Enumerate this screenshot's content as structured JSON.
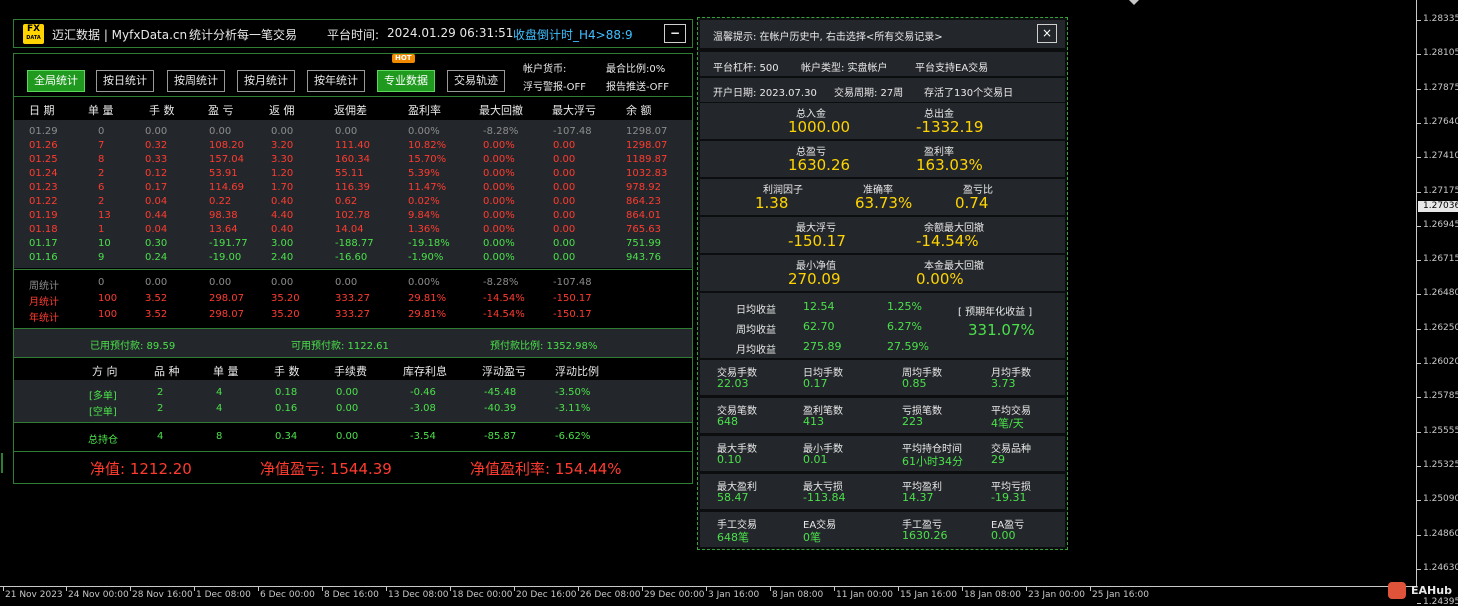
{
  "header": {
    "logo_top": "FX",
    "logo_bottom": "DATA",
    "title": "迈汇数据 | MyfxData.cn",
    "subtitle": "统计分析每一笔交易",
    "time_label": "平台时间:",
    "time_value": "2024.01.29 06:31:51",
    "countdown": "收盘倒计时_H4>88:9",
    "minimize": "−"
  },
  "tabs": [
    "全局统计",
    "按日统计",
    "按周统计",
    "按月统计",
    "按年统计",
    "专业数据",
    "交易轨迹"
  ],
  "hot_badge": "HOT",
  "side_info": {
    "currency": "帐户货币:",
    "margin": "最合比例:0%",
    "float_alert": "浮亏警报-OFF",
    "report_push": "报告推送-OFF"
  },
  "table_headers": [
    "日 期",
    "单 量",
    "手 数",
    "盈 亏",
    "返 佣",
    "返佣差",
    "盈利率",
    "最大回撤",
    "最大浮亏",
    "余 额"
  ],
  "daily_rows": [
    {
      "cells": [
        "01.29",
        "0",
        "0.00",
        "0.00",
        "0.00",
        "0.00",
        "0.00%",
        "-8.28%",
        "-107.48",
        "1298.07"
      ],
      "color": "gray"
    },
    {
      "cells": [
        "01.26",
        "7",
        "0.32",
        "108.20",
        "3.20",
        "111.40",
        "10.82%",
        "0.00%",
        "0.00",
        "1298.07"
      ],
      "color": "red"
    },
    {
      "cells": [
        "01.25",
        "8",
        "0.33",
        "157.04",
        "3.30",
        "160.34",
        "15.70%",
        "0.00%",
        "0.00",
        "1189.87"
      ],
      "color": "red"
    },
    {
      "cells": [
        "01.24",
        "2",
        "0.12",
        "53.91",
        "1.20",
        "55.11",
        "5.39%",
        "0.00%",
        "0.00",
        "1032.83"
      ],
      "color": "red"
    },
    {
      "cells": [
        "01.23",
        "6",
        "0.17",
        "114.69",
        "1.70",
        "116.39",
        "11.47%",
        "0.00%",
        "0.00",
        "978.92"
      ],
      "color": "red"
    },
    {
      "cells": [
        "01.22",
        "2",
        "0.04",
        "0.22",
        "0.40",
        "0.62",
        "0.02%",
        "0.00%",
        "0.00",
        "864.23"
      ],
      "color": "red"
    },
    {
      "cells": [
        "01.19",
        "13",
        "0.44",
        "98.38",
        "4.40",
        "102.78",
        "9.84%",
        "0.00%",
        "0.00",
        "864.01"
      ],
      "color": "red"
    },
    {
      "cells": [
        "01.18",
        "1",
        "0.04",
        "13.64",
        "0.40",
        "14.04",
        "1.36%",
        "0.00%",
        "0.00",
        "765.63"
      ],
      "color": "red"
    },
    {
      "cells": [
        "01.17",
        "10",
        "0.30",
        "-191.77",
        "3.00",
        "-188.77",
        "-19.18%",
        "0.00%",
        "0.00",
        "751.99"
      ],
      "color": "grn"
    },
    {
      "cells": [
        "01.16",
        "9",
        "0.24",
        "-19.00",
        "2.40",
        "-16.60",
        "-1.90%",
        "0.00%",
        "0.00",
        "943.76"
      ],
      "color": "grn"
    }
  ],
  "period_rows": [
    {
      "cells": [
        "周统计",
        "0",
        "0.00",
        "0.00",
        "0.00",
        "0.00",
        "0.00%",
        "-8.28%",
        "-107.48"
      ],
      "color": "gray"
    },
    {
      "cells": [
        "月统计",
        "100",
        "3.52",
        "298.07",
        "35.20",
        "333.27",
        "29.81%",
        "-14.54%",
        "-150.17"
      ],
      "color": "red"
    },
    {
      "cells": [
        "年统计",
        "100",
        "3.52",
        "298.07",
        "35.20",
        "333.27",
        "29.81%",
        "-14.54%",
        "-150.17"
      ],
      "color": "red"
    }
  ],
  "prepay": {
    "used": "已用预付款:  89.59",
    "available": "可用预付款:  1122.61",
    "ratio": "预付款比例:  1352.98%"
  },
  "position_headers": [
    "方 向",
    "品 种",
    "单 量",
    "手 数",
    "手续费",
    "库存利息",
    "浮动盈亏",
    "浮动比例"
  ],
  "position_rows": [
    [
      "[多单]",
      "2",
      "4",
      "0.18",
      "0.00",
      "-0.46",
      "-45.48",
      "-3.50%"
    ],
    [
      "[空单]",
      "2",
      "4",
      "0.16",
      "0.00",
      "-3.08",
      "-40.39",
      "-3.11%"
    ]
  ],
  "position_total": [
    "总持仓",
    "4",
    "8",
    "0.34",
    "0.00",
    "-3.54",
    "-85.87",
    "-6.62%"
  ],
  "equity": {
    "net": "净值:  1212.20",
    "net_pl": "净值盈亏:  1544.39",
    "net_rate": "净值盈利率:  154.44%"
  },
  "right": {
    "tip": "温馨提示:  在帐户历史中, 右击选择<所有交易记录>",
    "close": "×",
    "leverage": "平台杠杆:  500",
    "account_type": "帐户类型:  实盘帐户",
    "ea_support": "平台支持EA交易",
    "open_date": "开户日期:  2023.07.30",
    "cycle": "交易周期:  27周",
    "stored": "存活了130个交易日",
    "blocks": [
      [
        {
          "l": "总入金",
          "v": "1000.00"
        },
        {
          "l": "总出金",
          "v": "-1332.19"
        }
      ],
      [
        {
          "l": "总盈亏",
          "v": "1630.26"
        },
        {
          "l": "盈利率",
          "v": "163.03%"
        }
      ],
      [
        {
          "l": "利润因子",
          "v": "1.38"
        },
        {
          "l": "准确率",
          "v": "63.73%"
        },
        {
          "l": "盈亏比",
          "v": "0.74"
        }
      ],
      [
        {
          "l": "最大浮亏",
          "v": "-150.17"
        },
        {
          "l": "余额最大回撤",
          "v": "-14.54%"
        }
      ],
      [
        {
          "l": "最小净值",
          "v": "270.09"
        },
        {
          "l": "本金最大回撤",
          "v": "0.00%"
        }
      ]
    ],
    "avg": [
      {
        "l": "日均收益",
        "v": "12.54",
        "p": "1.25%"
      },
      {
        "l": "周均收益",
        "v": "62.70",
        "p": "6.27%"
      },
      {
        "l": "月均收益",
        "v": "275.89",
        "p": "27.59%"
      }
    ],
    "annual_label": "[ 预期年化收益 ]",
    "annual_value": "331.07%",
    "grid": [
      [
        {
          "l": "交易手数",
          "v": "22.03"
        },
        {
          "l": "日均手数",
          "v": "0.17"
        },
        {
          "l": "周均手数",
          "v": "0.85"
        },
        {
          "l": "月均手数",
          "v": "3.73"
        }
      ],
      [
        {
          "l": "交易笔数",
          "v": "648"
        },
        {
          "l": "盈利笔数",
          "v": "413"
        },
        {
          "l": "亏损笔数",
          "v": "223"
        },
        {
          "l": "平均交易",
          "v": "4笔/天"
        }
      ],
      [
        {
          "l": "最大手数",
          "v": "0.10"
        },
        {
          "l": "最小手数",
          "v": "0.01"
        },
        {
          "l": "平均持仓时间",
          "v": "61小时34分"
        },
        {
          "l": "交易品种",
          "v": "29"
        }
      ],
      [
        {
          "l": "最大盈利",
          "v": "58.47"
        },
        {
          "l": "最大亏损",
          "v": "-113.84"
        },
        {
          "l": "平均盈利",
          "v": "14.37"
        },
        {
          "l": "平均亏损",
          "v": "-19.31"
        }
      ],
      [
        {
          "l": "手工交易",
          "v": "648笔"
        },
        {
          "l": "EA交易",
          "v": "0笔"
        },
        {
          "l": "手工盈亏",
          "v": "1630.26"
        },
        {
          "l": "EA盈亏",
          "v": "0.00"
        }
      ]
    ]
  },
  "price_axis": [
    "1.28335",
    "1.28105",
    "1.27875",
    "1.27640",
    "1.27410",
    "1.27175",
    "1.26945",
    "1.26715",
    "1.26480",
    "1.26250",
    "1.26020",
    "1.25785",
    "1.25555",
    "1.25325",
    "1.25090",
    "1.24860",
    "1.24630",
    "1.24395"
  ],
  "current_price": "1.27036",
  "time_axis": [
    "21 Nov 2023",
    "24 Nov 00:00",
    "28 Nov 16:00",
    "1 Dec 08:00",
    "6 Dec 00:00",
    "8 Dec 16:00",
    "13 Dec 08:00",
    "18 Dec 00:00",
    "20 Dec 16:00",
    "26 Dec 08:00",
    "29 Dec 00:00",
    "3 Jan 16:00",
    "8 Jan 08:00",
    "11 Jan 00:00",
    "15 Jan 16:00",
    "18 Jan 08:00",
    "23 Jan 00:00",
    "25 Jan 16:00"
  ],
  "watermark": "EAHub",
  "colors": {
    "green": "#4be04b",
    "red": "#ff3b30",
    "yellow": "#ffd400",
    "border": "#2e7d32",
    "accent": "#1f9a1f"
  }
}
